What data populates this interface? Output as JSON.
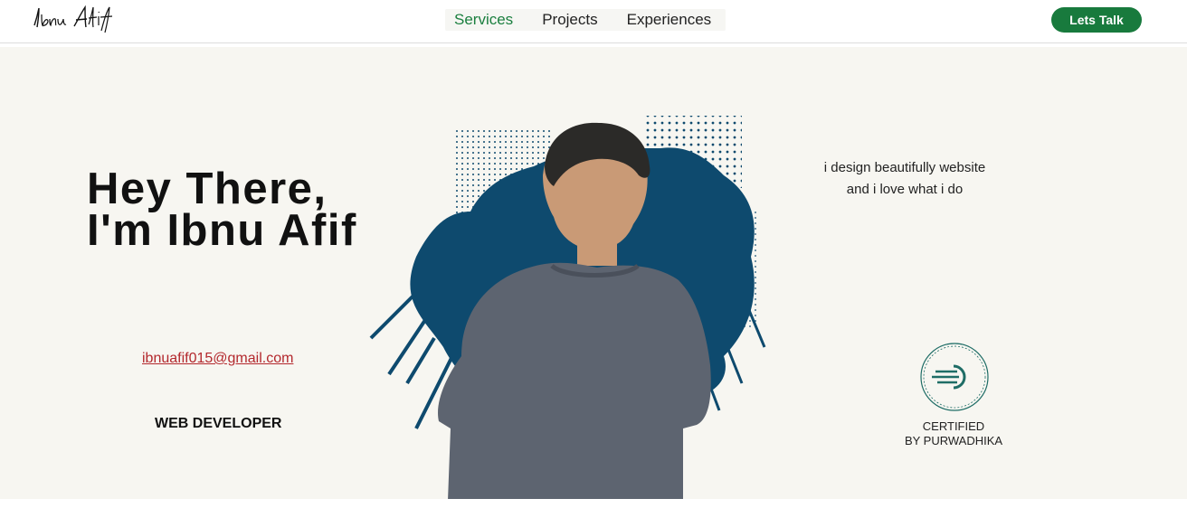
{
  "header": {
    "logo_text": "Ibnu Afif",
    "nav": [
      {
        "label": "Services"
      },
      {
        "label": "Projects"
      },
      {
        "label": "Experiences"
      }
    ],
    "cta_label": "Lets Talk"
  },
  "hero": {
    "greeting_line1": "Hey There,",
    "greeting_line2": "I'm Ibnu Afif",
    "email": "ibnuafif015@gmail.com",
    "role": "WEB DEVELOPER",
    "tagline_line1": "i design beautifully website",
    "tagline_line2": "and i love what i do",
    "cert_line1": "CERTIFIED",
    "cert_line2": "BY PURWADHIKA",
    "badge_icon": "speed-lines-circle-icon"
  },
  "colors": {
    "accent": "#187a3d",
    "nav_active": "#1b7f3f",
    "email": "#b3282d",
    "splash": "#0e4a6e",
    "badge": "#1f6d66",
    "hero_bg": "#f7f6f1"
  }
}
